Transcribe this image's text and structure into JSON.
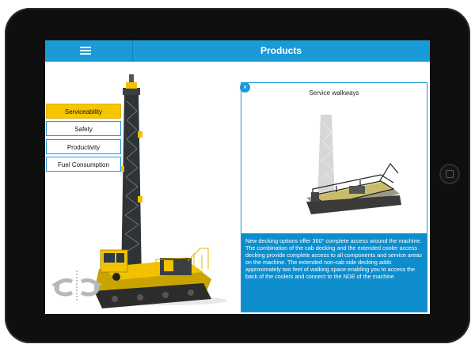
{
  "header": {
    "title": "Products",
    "menu_icon": "hamburger-menu-icon"
  },
  "feature_tabs": [
    {
      "label": "Serviceability",
      "active": true
    },
    {
      "label": "Safety",
      "active": false
    },
    {
      "label": "Productivity",
      "active": false
    },
    {
      "label": "Fuel Consumption",
      "active": false
    }
  ],
  "detail_panel": {
    "close_label": "×",
    "title": "Service walkways",
    "description": "New decking options offer 360° complete access around the machine. The combination of the cab decking and the extended cooler access decking provide complete access to all components and service areas on the machine.  The extended non-cab side decking adds approximately two feet of walking space enabling you to access the back of the coolers and connect to the NDE of the machine"
  },
  "colors": {
    "accent": "#1a9ad6",
    "active_tab": "#f7c600",
    "machine_yellow": "#f2c200",
    "description_bg": "#0e8dcd"
  }
}
